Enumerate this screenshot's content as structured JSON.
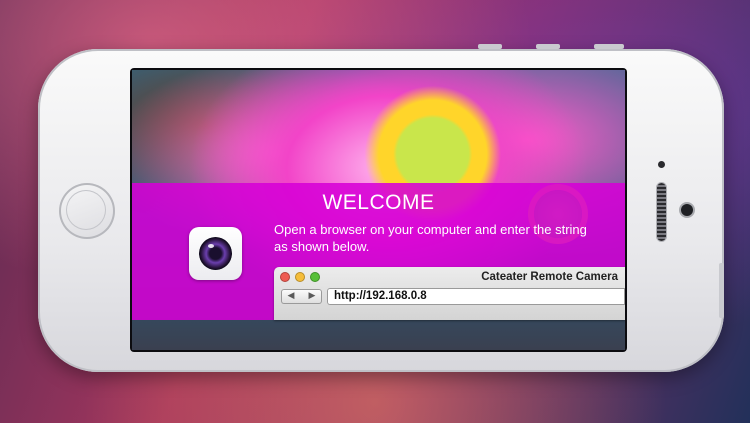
{
  "welcome": {
    "title": "WELCOME",
    "instructions": "Open a browser on your computer and enter the string as shown below."
  },
  "browser": {
    "window_title": "Cateater Remote Camera",
    "url": "http://192.168.0.8",
    "back_glyph": "◀",
    "forward_glyph": "▶"
  },
  "app_icon": {
    "name": "camera-lens-icon"
  },
  "colors": {
    "welcome_band": "#d600d6",
    "traffic_close": "#ee5b52",
    "traffic_minimize": "#f5bd3a",
    "traffic_zoom": "#57c038"
  }
}
